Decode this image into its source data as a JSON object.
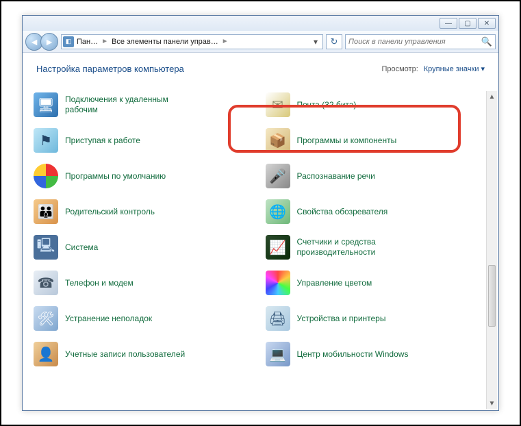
{
  "titlebar": {
    "minimize": "—",
    "maximize": "▢",
    "close": "✕"
  },
  "toolbar": {
    "back": "◄",
    "forward": "►",
    "breadcrumb": {
      "seg1": "Пан…",
      "seg2": "Все элементы панели управ…",
      "sep": "►"
    },
    "refresh": "↻",
    "search_placeholder": "Поиск в панели управления",
    "search_icon": "🔍"
  },
  "header": {
    "title": "Настройка параметров компьютера",
    "view_label": "Просмотр:",
    "view_value": "Крупные значки"
  },
  "items_left": [
    {
      "label": "Подключения к удаленным рабочим",
      "icon_class": "ic-blue",
      "glyph": "🖥"
    },
    {
      "label": "Приступая к работе",
      "icon_class": "ic-cyan",
      "glyph": "⚑"
    },
    {
      "label": "Программы по умолчанию",
      "icon_class": "ic-mc",
      "glyph": ""
    },
    {
      "label": "Родительский контроль",
      "icon_class": "ic-people",
      "glyph": "👪"
    },
    {
      "label": "Система",
      "icon_class": "ic-mon",
      "glyph": "🖳"
    },
    {
      "label": "Телефон и модем",
      "icon_class": "ic-phone",
      "glyph": "☎"
    },
    {
      "label": "Устранение неполадок",
      "icon_class": "ic-fix",
      "glyph": "🛠"
    },
    {
      "label": "Учетные записи пользователей",
      "icon_class": "ic-users",
      "glyph": "👤"
    }
  ],
  "items_right": [
    {
      "label": "Почта (32 бита)",
      "icon_class": "ic-mail",
      "glyph": "✉"
    },
    {
      "label": "Программы и компоненты",
      "icon_class": "ic-box",
      "glyph": "📦"
    },
    {
      "label": "Распознавание речи",
      "icon_class": "ic-mic",
      "glyph": "🎤"
    },
    {
      "label": "Свойства обозревателя",
      "icon_class": "ic-net",
      "glyph": "🌐"
    },
    {
      "label": "Счетчики и средства производительности",
      "icon_class": "ic-perf",
      "glyph": "📈"
    },
    {
      "label": "Управление цветом",
      "icon_class": "ic-color",
      "glyph": ""
    },
    {
      "label": "Устройства и принтеры",
      "icon_class": "ic-dev",
      "glyph": "🖨"
    },
    {
      "label": "Центр мобильности Windows",
      "icon_class": "ic-mob",
      "glyph": "💻"
    }
  ]
}
